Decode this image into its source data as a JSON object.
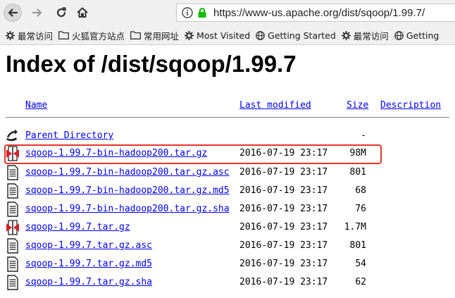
{
  "browser": {
    "url": "https://www-us.apache.org/dist/sqoop/1.99.7/",
    "bookmarks": [
      "最常访问",
      "火狐官方站点",
      "常用网址",
      "Most Visited",
      "Getting Started",
      "最常访问",
      "Getting"
    ]
  },
  "page": {
    "title": "Index of /dist/sqoop/1.99.7",
    "columns": {
      "name": "Name",
      "last_modified": "Last modified",
      "size": "Size",
      "description": "Description"
    },
    "parent": {
      "name": "Parent Directory",
      "size": "-"
    },
    "files": [
      {
        "name": "sqoop-1.99.7-bin-hadoop200.tar.gz",
        "modified": "2016-07-19 23:17",
        "size": "98M",
        "icon": "archive-icon"
      },
      {
        "name": "sqoop-1.99.7-bin-hadoop200.tar.gz.asc",
        "modified": "2016-07-19 23:17",
        "size": "801",
        "icon": "text-file-icon"
      },
      {
        "name": "sqoop-1.99.7-bin-hadoop200.tar.gz.md5",
        "modified": "2016-07-19 23:17",
        "size": "68",
        "icon": "text-file-icon"
      },
      {
        "name": "sqoop-1.99.7-bin-hadoop200.tar.gz.sha",
        "modified": "2016-07-19 23:17",
        "size": "76",
        "icon": "text-file-icon"
      },
      {
        "name": "sqoop-1.99.7.tar.gz",
        "modified": "2016-07-19 23:17",
        "size": "1.7M",
        "icon": "archive-icon"
      },
      {
        "name": "sqoop-1.99.7.tar.gz.asc",
        "modified": "2016-07-19 23:17",
        "size": "801",
        "icon": "text-file-icon"
      },
      {
        "name": "sqoop-1.99.7.tar.gz.md5",
        "modified": "2016-07-19 23:17",
        "size": "54",
        "icon": "text-file-icon"
      },
      {
        "name": "sqoop-1.99.7.tar.gz.sha",
        "modified": "2016-07-19 23:17",
        "size": "62",
        "icon": "text-file-icon"
      }
    ],
    "highlight_color": "#e0362b",
    "link_color": "#0000ee"
  }
}
